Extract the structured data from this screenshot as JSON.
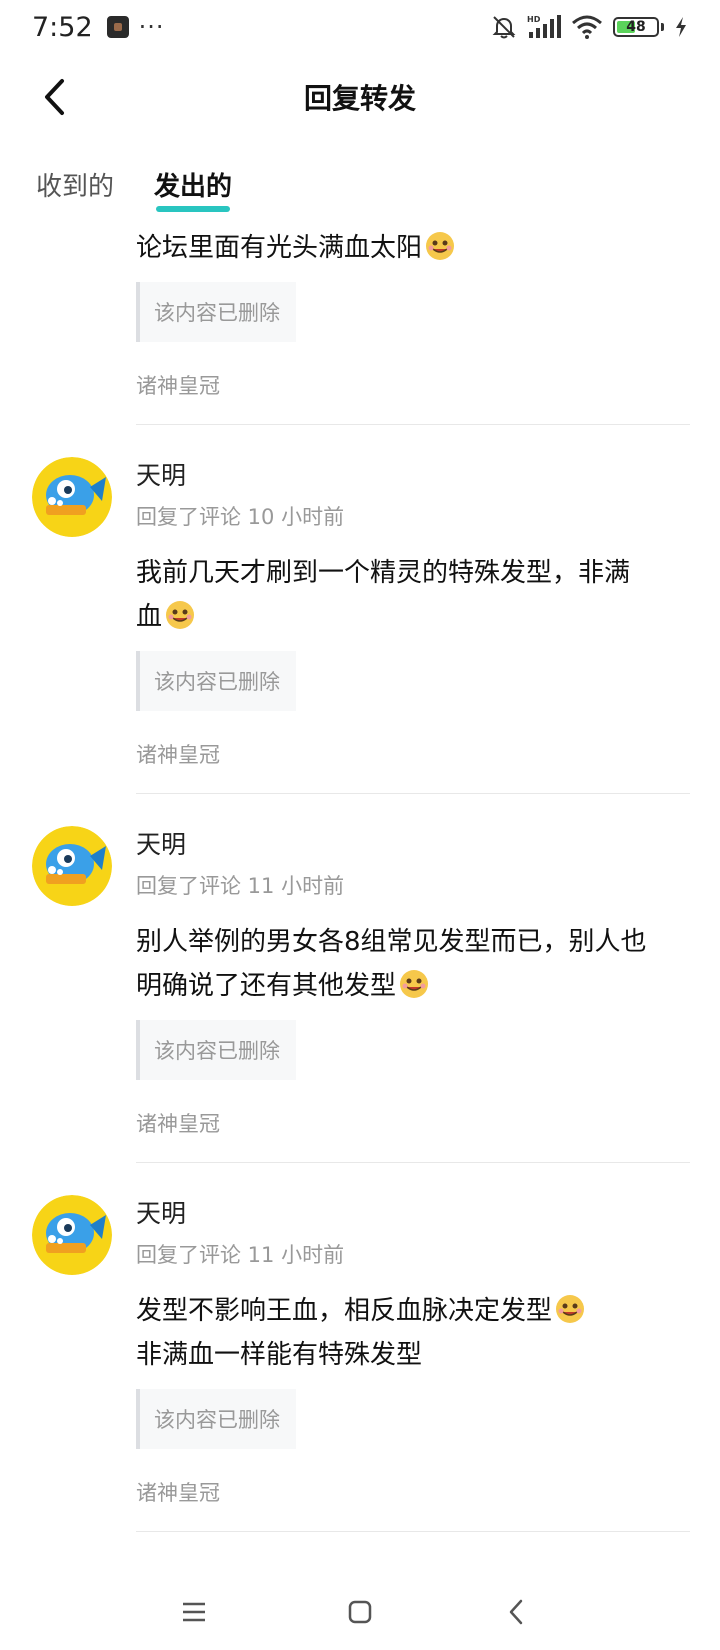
{
  "status_bar": {
    "time": "7:52",
    "more": "···",
    "battery_level": "48",
    "battery_fraction": 0.48,
    "icons": [
      "mute-bell-icon",
      "hd-signal-icon",
      "wifi-icon",
      "battery-icon",
      "charging-icon"
    ]
  },
  "nav": {
    "title": "回复转发",
    "back_icon": "chevron-left-icon"
  },
  "tabs": [
    {
      "label": "收到的",
      "active": false
    },
    {
      "label": "发出的",
      "active": true
    }
  ],
  "items": [
    {
      "has_header": false,
      "text": "论坛里面有光头满血太阳",
      "text_line2": "",
      "quote": "该内容已删除",
      "source": "诸神皇冠"
    },
    {
      "has_header": true,
      "user": "天明",
      "meta": "回复了评论 10 小时前",
      "text": "我前几天才刷到一个精灵的特殊发型，非满",
      "text_line2": "血",
      "quote": "该内容已删除",
      "source": "诸神皇冠"
    },
    {
      "has_header": true,
      "user": "天明",
      "meta": "回复了评论 11 小时前",
      "text": "别人举例的男女各8组常见发型而已，别人也",
      "text_line2": "明确说了还有其他发型",
      "quote": "该内容已删除",
      "source": "诸神皇冠"
    },
    {
      "has_header": true,
      "user": "天明",
      "meta": "回复了评论 11 小时前",
      "text": "发型不影响王血，相反血脉决定发型",
      "text_line2": "非满血一样能有特殊发型",
      "quote": "该内容已删除",
      "source": "诸神皇冠"
    }
  ],
  "colors": {
    "accent": "#29c5c0",
    "muted_text": "#999999",
    "divider": "#e8e8e8"
  },
  "system_nav": [
    "menu-icon",
    "home-icon",
    "back-icon"
  ]
}
